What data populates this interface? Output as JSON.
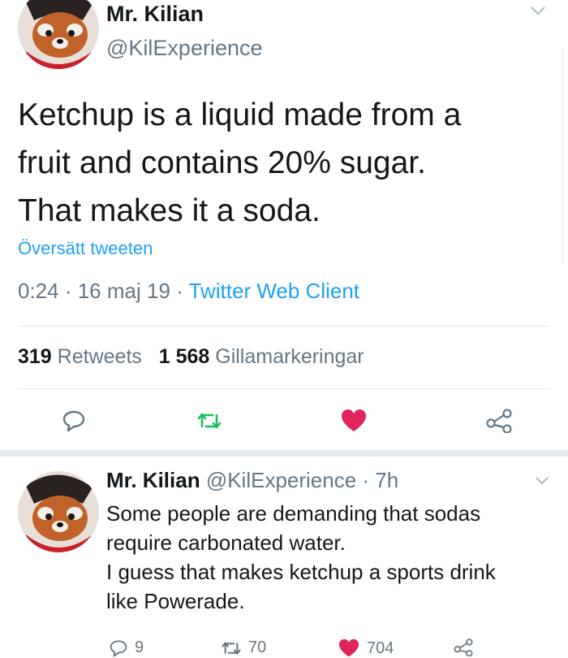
{
  "tweet": {
    "author_name": "Mr. Kilian",
    "author_handle": "@KilExperience",
    "text_lines": [
      "Ketchup is a liquid made from a",
      "fruit and contains 20% sugar.",
      "That makes it a soda."
    ],
    "translate_link": "Översätt tweeten",
    "time": "0:24",
    "sep1": " · ",
    "date": "16 maj 19",
    "sep2": " · ",
    "client": "Twitter Web Client",
    "retweet_count": "319",
    "retweet_label": "Retweets",
    "like_count": "1 568",
    "like_label": "Gillamarkeringar"
  },
  "reply": {
    "author_name": "Mr. Kilian",
    "meta": "@KilExperience · 7h",
    "text_lines": [
      "Some people are demanding that sodas",
      "require carbonated water.",
      "I guess that makes ketchup a sports drink",
      "like Powerade."
    ],
    "reply_count": "9",
    "retweet_count": "70",
    "like_count": "704"
  },
  "colors": {
    "accent": "#1da1f2",
    "retweet_green": "#17bf63",
    "like_red": "#e0245e",
    "muted": "#657786"
  },
  "icons": [
    "chevron-down-icon",
    "reply-icon",
    "retweet-icon",
    "heart-icon",
    "share-icon"
  ]
}
